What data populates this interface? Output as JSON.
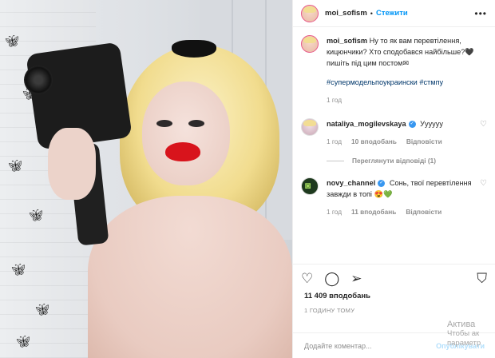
{
  "post": {
    "username": "moi_sofism",
    "follow_label": "Стежити",
    "caption_user": "moi_sofism",
    "caption": "Ну то як вам перевтілення, кицюнчики? Хто сподобався найбільше?🖤 пишіть під цим постом✉",
    "hashtags": "#супермодельпоукраински #стмпу",
    "caption_time": "1 год",
    "likes": "11 409 вподобань",
    "posted_ago": "1 ГОДИНУ ТОМУ"
  },
  "comments": [
    {
      "user": "nataliya_mogilevskaya",
      "text": "Уууууу",
      "time": "1 год",
      "likes": "10 вподобань",
      "reply": "Відповісти",
      "view_replies": "Переглянути відповіді (1)"
    },
    {
      "user": "novy_channel",
      "text": "Сонь, твої перевтілення завжди в топі 😍💚",
      "time": "1 год",
      "likes": "11 вподобань",
      "reply": "Відповісти"
    }
  ],
  "composer": {
    "placeholder": "Додайте коментар...",
    "publish_label": "Опублікувати"
  },
  "watermark": {
    "line1": "Актива",
    "line2": "Чтобы ак",
    "line3": "параметр"
  },
  "icons": {
    "like": "heart-icon",
    "comment": "comment-icon",
    "share": "share-icon",
    "save": "bookmark-icon",
    "more": "more-options-icon",
    "verified": "verified-badge-icon"
  },
  "colors": {
    "link": "#0095f6",
    "hashtag": "#00376b",
    "verified": "#3897f0",
    "muted": "#8e8e8e",
    "lips": "#d8141c"
  }
}
